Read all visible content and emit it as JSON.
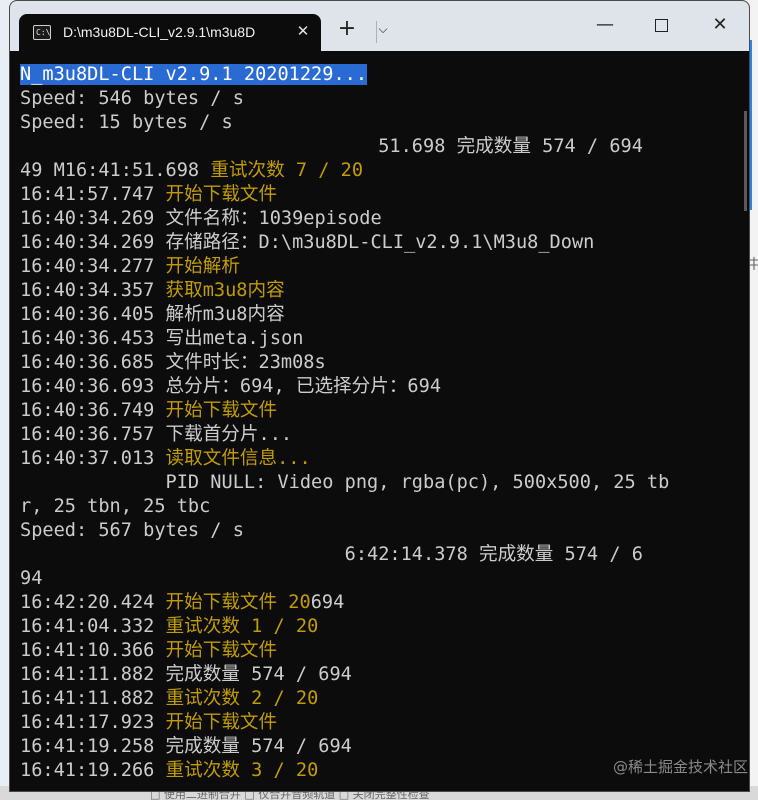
{
  "window": {
    "tab_title": "D:\\m3u8DL-CLI_v2.9.1\\m3u8D",
    "tab_icon_text": "C:\\"
  },
  "controls": {
    "new_tab": "+",
    "dropdown": "⌵",
    "minimize": "—",
    "close_tab": "✕",
    "close_window": "✕"
  },
  "terminal": {
    "lines": [
      [
        {
          "t": "N_m3u8DL-CLI v2.9.1 20201229...",
          "c": "sel"
        }
      ],
      [
        {
          "t": "Speed: 546 bytes / s",
          "c": "w"
        }
      ],
      [
        {
          "t": "Speed: 15 bytes / s",
          "c": "w"
        }
      ],
      [
        {
          "t": "                                51.698 完成数量 574 / 694",
          "c": "w"
        }
      ],
      [
        {
          "t": "49 M16:41:51.698 ",
          "c": "w"
        },
        {
          "t": "重试次数 7 / 20",
          "c": "y"
        }
      ],
      [
        {
          "t": "16:41:57.747 ",
          "c": "w"
        },
        {
          "t": "开始下载文件",
          "c": "y"
        }
      ],
      [
        {
          "t": "16:40:34.269 文件名称：1039episode",
          "c": "w"
        }
      ],
      [
        {
          "t": "16:40:34.269 存储路径：D:\\m3u8DL-CLI_v2.9.1\\M3u8_Down",
          "c": "w"
        }
      ],
      [
        {
          "t": "16:40:34.277 ",
          "c": "w"
        },
        {
          "t": "开始解析",
          "c": "y"
        }
      ],
      [
        {
          "t": "16:40:34.357 ",
          "c": "w"
        },
        {
          "t": "获取m3u8内容",
          "c": "y"
        }
      ],
      [
        {
          "t": "16:40:36.405 解析m3u8内容",
          "c": "w"
        }
      ],
      [
        {
          "t": "16:40:36.453 写出meta.json",
          "c": "w"
        }
      ],
      [
        {
          "t": "16:40:36.685 文件时长：23m08s",
          "c": "w"
        }
      ],
      [
        {
          "t": "16:40:36.693 总分片：694, 已选择分片：694",
          "c": "w"
        }
      ],
      [
        {
          "t": "16:40:36.749 ",
          "c": "w"
        },
        {
          "t": "开始下载文件",
          "c": "y"
        }
      ],
      [
        {
          "t": "16:40:36.757 下载首分片...",
          "c": "w"
        }
      ],
      [
        {
          "t": "16:40:37.013 ",
          "c": "w"
        },
        {
          "t": "读取文件信息...",
          "c": "y"
        }
      ],
      [
        {
          "t": "             PID NULL: Video png, rgba(pc), 500x500, 25 tb",
          "c": "w"
        }
      ],
      [
        {
          "t": "r, 25 tbn, 25 tbc",
          "c": "w"
        }
      ],
      [
        {
          "t": "Speed: 567 bytes / s",
          "c": "w"
        }
      ],
      [
        {
          "t": "                             6:42:14.378 完成数量 574 / 6",
          "c": "w"
        }
      ],
      [
        {
          "t": "94",
          "c": "w"
        }
      ],
      [
        {
          "t": "16:42:20.424 ",
          "c": "w"
        },
        {
          "t": "开始下载文件 20",
          "c": "y"
        },
        {
          "t": "694",
          "c": "w"
        }
      ],
      [
        {
          "t": "16:41:04.332 ",
          "c": "w"
        },
        {
          "t": "重试次数 1 / 20",
          "c": "y"
        }
      ],
      [
        {
          "t": "16:41:10.366 ",
          "c": "w"
        },
        {
          "t": "开始下载文件",
          "c": "y"
        }
      ],
      [
        {
          "t": "16:41:11.882 完成数量 574 / 694",
          "c": "w"
        }
      ],
      [
        {
          "t": "16:41:11.882 ",
          "c": "w"
        },
        {
          "t": "重试次数 2 / 20",
          "c": "y"
        }
      ],
      [
        {
          "t": "16:41:17.923 ",
          "c": "w"
        },
        {
          "t": "开始下载文件",
          "c": "y"
        }
      ],
      [
        {
          "t": "16:41:19.258 完成数量 574 / 694",
          "c": "w"
        }
      ],
      [
        {
          "t": "16:41:19.266 ",
          "c": "w"
        },
        {
          "t": "重试次数 3 / 20",
          "c": "y"
        }
      ]
    ]
  },
  "watermark": "@稀土掘金技术社区",
  "background": {
    "right_glyph": "中",
    "bottom_text": "□ 使用二进制合并   □ 仅合并音频轨道   □ 关闭完整性检查"
  },
  "colors": {
    "terminal_bg": "#0c0c0c",
    "text": "#cccccc",
    "highlight": "#c19c00",
    "selection": "#2a6bd3",
    "titlebar": "#dfe4ea"
  }
}
